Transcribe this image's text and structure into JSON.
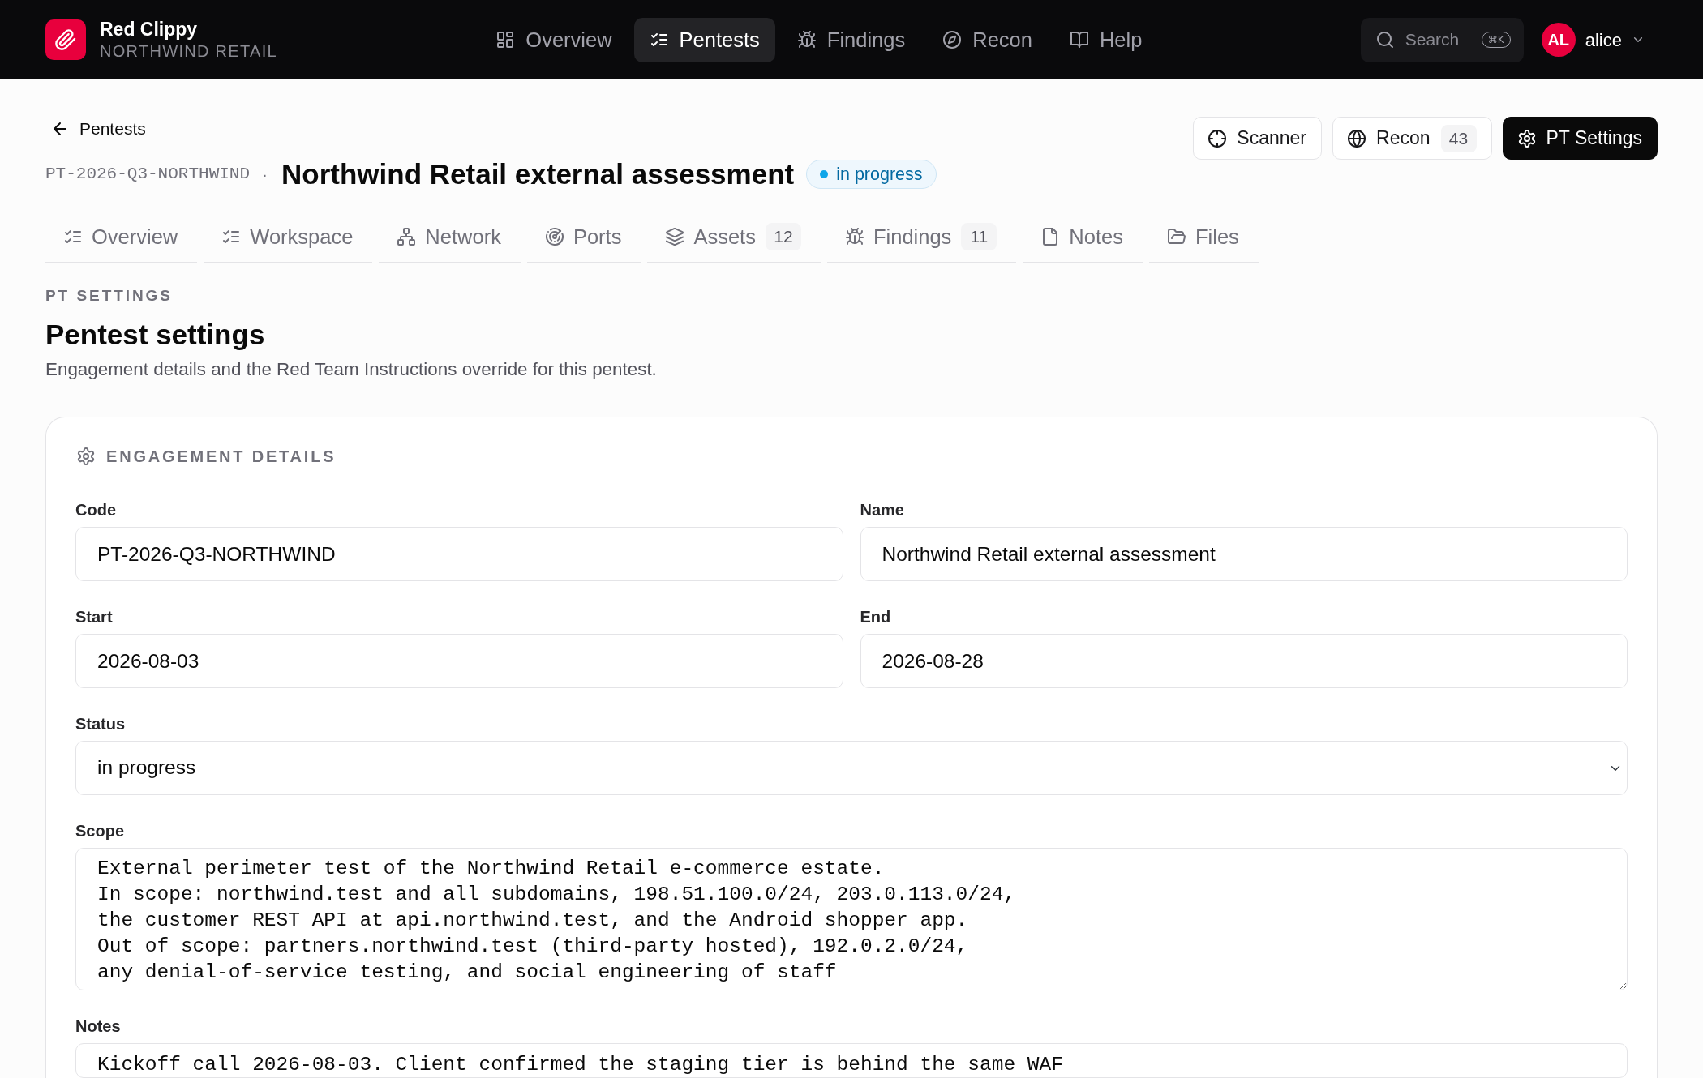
{
  "navbar": {
    "brand": {
      "name": "Red Clippy",
      "subtitle": "NORTHWIND RETAIL"
    },
    "items": [
      {
        "label": "Overview",
        "selected": false
      },
      {
        "label": "Pentests",
        "selected": true
      },
      {
        "label": "Findings",
        "selected": false
      },
      {
        "label": "Recon",
        "selected": false
      },
      {
        "label": "Help",
        "selected": false
      }
    ],
    "search": {
      "placeholder": "Search",
      "shortcut": "⌘K"
    },
    "user": {
      "initials": "AL",
      "name": "alice"
    }
  },
  "page_header": {
    "back_link": "Pentests",
    "code": "PT-2026-Q3-NORTHWIND",
    "separator": "·",
    "title": "Northwind Retail external assessment",
    "status": "in progress",
    "actions": [
      {
        "label": "Scanner",
        "kind": "outline"
      },
      {
        "label": "Recon",
        "count": "43",
        "kind": "outline"
      },
      {
        "label": "PT Settings",
        "kind": "primary"
      }
    ]
  },
  "tabs": [
    {
      "label": "Overview",
      "selected": false
    },
    {
      "label": "Workspace",
      "selected": false
    },
    {
      "label": "Network",
      "selected": false
    },
    {
      "label": "Ports",
      "selected": false
    },
    {
      "label": "Assets",
      "count": "12",
      "selected": false
    },
    {
      "label": "Findings",
      "count": "11",
      "selected": false
    },
    {
      "label": "Notes",
      "selected": false
    },
    {
      "label": "Files",
      "selected": false
    }
  ],
  "section": {
    "eyebrow": "PT SETTINGS",
    "title": "Pentest settings",
    "description": "Engagement details and the Red Team Instructions override for this pentest."
  },
  "card": {
    "title": "ENGAGEMENT DETAILS",
    "fields": [
      {
        "label": "Code",
        "kind": "text",
        "value": "PT-2026-Q3-NORTHWIND"
      },
      {
        "label": "Name",
        "kind": "text",
        "value": "Northwind Retail external assessment"
      },
      {
        "label": "Start",
        "kind": "text",
        "value": "2026-08-03"
      },
      {
        "label": "End",
        "kind": "text",
        "value": "2026-08-28"
      },
      {
        "label": "Status",
        "kind": "select",
        "value": "in progress"
      },
      {
        "label": "Scope",
        "kind": "textarea",
        "value": "External perimeter test of the Northwind Retail e-commerce estate.\nIn scope: northwind.test and all subdomains, 198.51.100.0/24, 203.0.113.0/24,\nthe customer REST API at api.northwind.test, and the Android shopper app.\nOut of scope: partners.northwind.test (third-party hosted), 192.0.2.0/24,\nany denial-of-service testing, and social engineering of staff"
      },
      {
        "label": "Notes",
        "kind": "textarea",
        "value": "Kickoff call 2026-08-03. Client confirmed the staging tier is behind the same WAF"
      }
    ]
  }
}
